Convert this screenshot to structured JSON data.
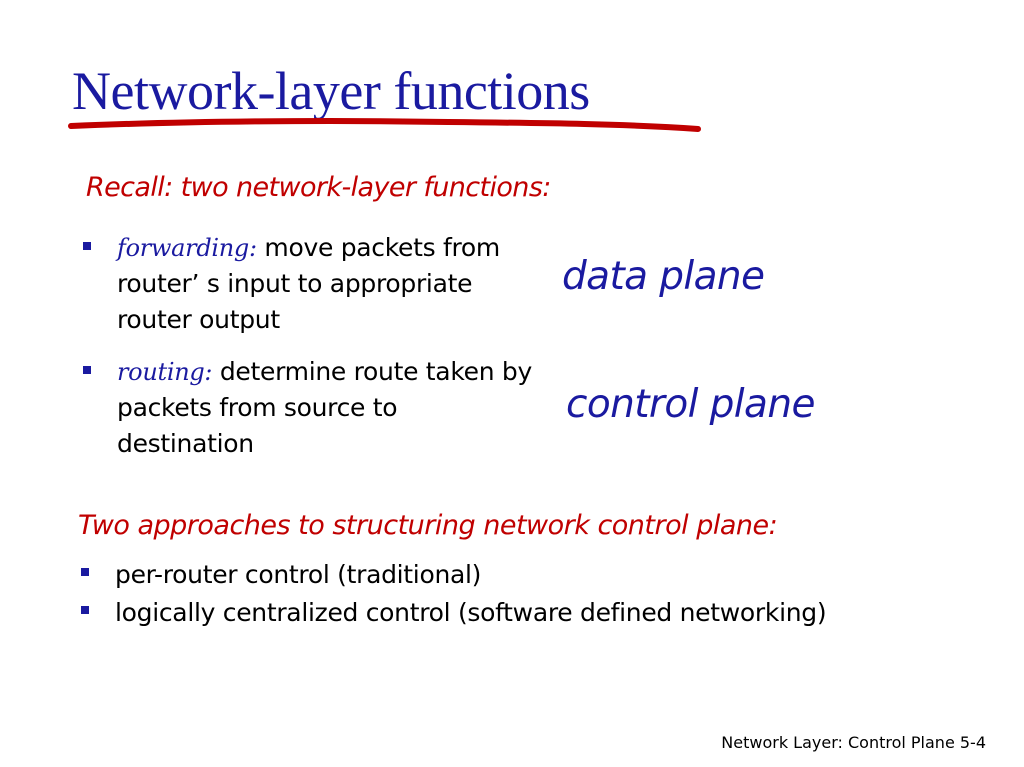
{
  "slide": {
    "title": "Network-layer functions",
    "recall_heading": "Recall: two network-layer functions:",
    "functions": [
      {
        "term": "forwarding:",
        "text": " move packets from router’ s input to appropriate router output"
      },
      {
        "term": "routing:",
        "text": " determine route taken by packets from source to destination"
      }
    ],
    "data_plane_label": "data plane",
    "control_plane_label": "control plane",
    "approaches_heading": "Two approaches to structuring network control plane:",
    "approaches": [
      "per-router control (traditional)",
      "logically centralized control (software defined networking)"
    ],
    "footer": "Network Layer: Control Plane  5-4"
  },
  "colors": {
    "title_blue": "#1a1aa0",
    "accent_red": "#c00000",
    "bullet": "#1a1aa0"
  }
}
